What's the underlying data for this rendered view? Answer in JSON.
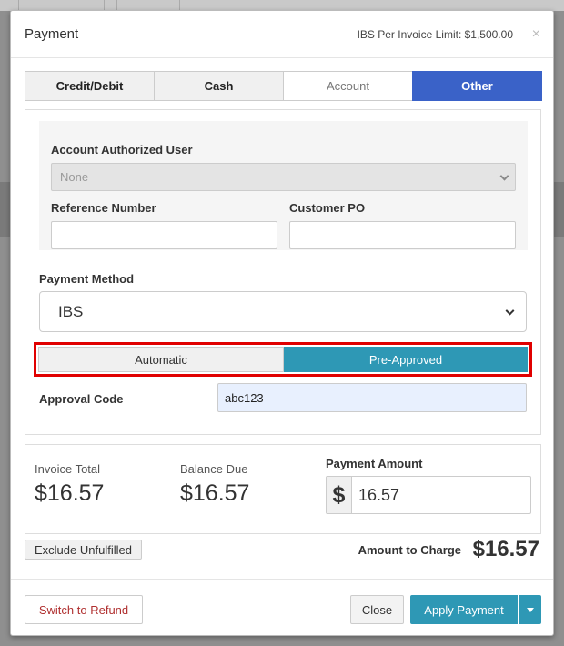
{
  "modal": {
    "title": "Payment",
    "invoice_limit": "IBS Per Invoice Limit: $1,500.00",
    "close_glyph": "×"
  },
  "tabs": [
    {
      "label": "Credit/Debit"
    },
    {
      "label": "Cash"
    },
    {
      "label": "Account"
    },
    {
      "label": "Other",
      "active": true
    }
  ],
  "form": {
    "authorized_user_label": "Account Authorized User",
    "authorized_user_value": "None",
    "reference_label": "Reference Number",
    "reference_value": "",
    "customer_po_label": "Customer PO",
    "customer_po_value": "",
    "payment_method_label": "Payment Method",
    "payment_method_value": "IBS",
    "approval_mode_options": [
      "Automatic",
      "Pre-Approved"
    ],
    "approval_mode_selected": "Pre-Approved",
    "approval_code_label": "Approval Code",
    "approval_code_value": "abc123"
  },
  "totals": {
    "invoice_total_label": "Invoice Total",
    "invoice_total_value": "$16.57",
    "balance_due_label": "Balance Due",
    "balance_due_value": "$16.57",
    "payment_amount_label": "Payment Amount",
    "currency_symbol": "$",
    "payment_amount_value": "16.57"
  },
  "summary": {
    "exclude_label": "Exclude Unfulfilled",
    "amount_to_charge_label": "Amount to Charge",
    "amount_to_charge_value": "$16.57"
  },
  "footer": {
    "refund_label": "Switch to Refund",
    "close_label": "Close",
    "apply_label": "Apply Payment"
  },
  "colors": {
    "active_tab": "#3a62c8",
    "primary": "#2e98b5",
    "highlight": "#e00000",
    "refund_text": "#b03030"
  }
}
